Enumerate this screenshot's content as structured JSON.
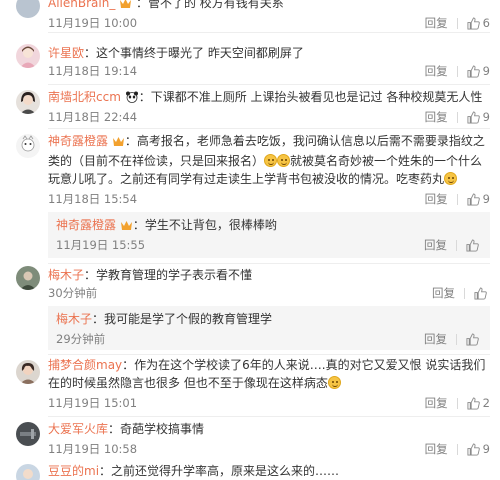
{
  "ui": {
    "reply_label": "回复"
  },
  "comments": [
    {
      "user": "AlienBrain_",
      "text": "：管不了的 校方有钱有关系",
      "time": "11月19日 10:00",
      "likes": "6"
    },
    {
      "user": "许星欧",
      "text": "：这个事情终于曝光了  昨天空间都刷屏了",
      "time": "11月18日 19:14",
      "likes": "9"
    },
    {
      "user": "南墙北积ccm",
      "text": "：下课都不准上厕所 上课抬头被看见也是记过 各种校规莫无人性",
      "time": "11月18日 22:44",
      "likes": "9"
    },
    {
      "user": "神奇露橙露",
      "text_a": "：高考报名，老师急着去吃饭，我问确认信息以后需不需要录指纹之类的（目前不在祥俭读，只是回来报名）",
      "text_b": "就被莫名奇妙被一个姓朱的一个什么玩意儿吼了。之前还有同学有过走读生上学背书包被没收的情况。吃枣药丸",
      "time": "11月18日 15:54",
      "likes": "9"
    },
    {
      "user": "神奇露橙露",
      "text": "：学生不让背包，很棒棒哟",
      "time": "11月19日 15:55",
      "likes": ""
    },
    {
      "user": "梅木子",
      "text": "：学教育管理的学子表示看不懂",
      "time": "30分钟前",
      "likes": ""
    },
    {
      "user": "梅木子",
      "text": "：我可能是学了个假的教育管理学",
      "time": "29分钟前",
      "likes": ""
    },
    {
      "user": "捕梦合颜may",
      "text": "：作为在这个学校读了6年的人来说….真的对它又爱又恨 说实话我们在的时候虽然隐言也很多 但也不至于像现在这样病态",
      "time": "11月19日 15:01",
      "likes": "2"
    },
    {
      "user": "大爱军火库",
      "text": "：奇葩学校搞事情",
      "time": "11月19日 10:58",
      "likes": "9"
    },
    {
      "user": "豆豆的mi",
      "text": "：之前还觉得升学率高，原来是这么来的……",
      "time": "",
      "likes": ""
    }
  ]
}
